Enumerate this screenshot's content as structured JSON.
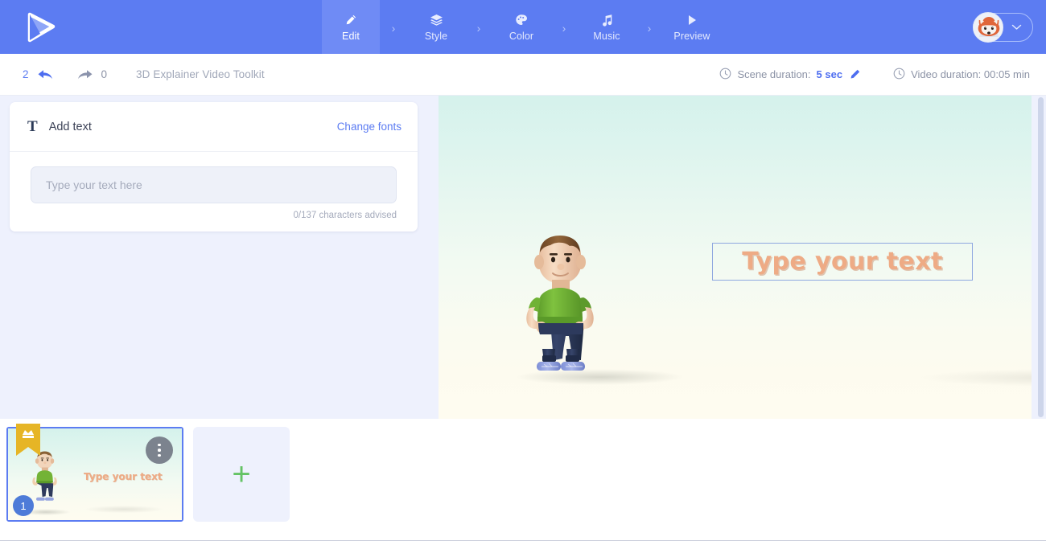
{
  "app": {
    "logo_name": "play-triangle-logo",
    "brand_blue": "#5c7cf2",
    "accent_green": "#64c364",
    "stage_text_color": "#eeab85"
  },
  "topnav": {
    "steps": [
      {
        "label": "Edit",
        "icon": "pencil-icon",
        "active": true
      },
      {
        "label": "Style",
        "icon": "layers-icon",
        "active": false
      },
      {
        "label": "Color",
        "icon": "palette-icon",
        "active": false
      },
      {
        "label": "Music",
        "icon": "music-note-icon",
        "active": false
      },
      {
        "label": "Preview",
        "icon": "play-icon",
        "active": false
      }
    ],
    "separator": "›",
    "account": {
      "avatar_icon": "fox-avatar",
      "chevron_icon": "chevron-down-icon"
    }
  },
  "subbar": {
    "undo_count": "2",
    "undo_icon": "undo-arrow-icon",
    "redo_count": "0",
    "redo_icon": "redo-arrow-icon",
    "project_title": "3D Explainer Video Toolkit",
    "scene_duration_label": "Scene duration:",
    "scene_duration_value": "5 sec",
    "scene_duration_edit_icon": "pencil-icon",
    "video_duration_text": "Video duration: 00:05 min",
    "clock_icon": "clock-icon"
  },
  "panel": {
    "icon": "text-T-icon",
    "title": "Add text",
    "action_label": "Change fonts",
    "input_placeholder": "Type your text here",
    "input_value": "",
    "char_counter": "0/137 characters advised"
  },
  "stage": {
    "text_placeholder": "Type your text",
    "character_name": "3d-male-character"
  },
  "timeline": {
    "scenes": [
      {
        "number": "1",
        "text": "Type your text",
        "premium_badge_icon": "crown-ribbon-icon",
        "menu_icon": "three-dots-icon",
        "selected": true
      }
    ],
    "add_scene_icon": "plus-icon"
  }
}
